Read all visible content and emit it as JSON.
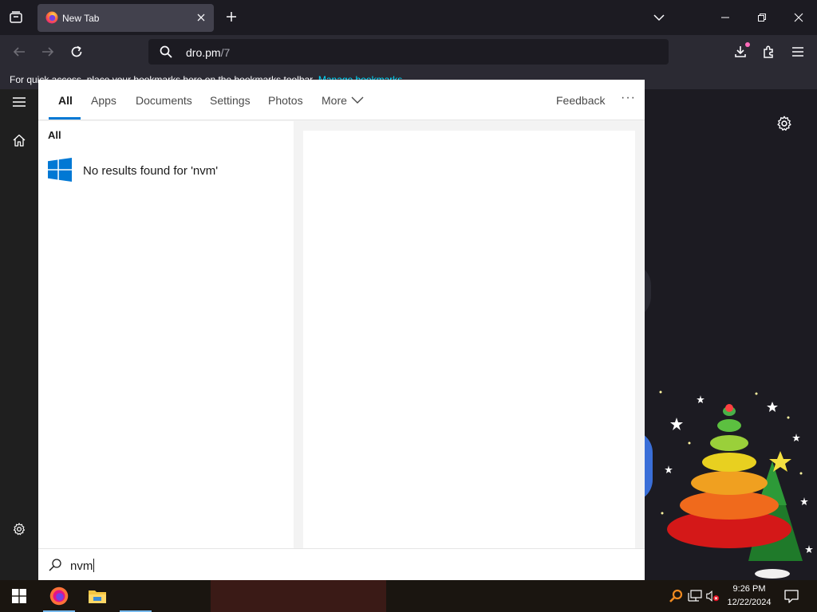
{
  "browser": {
    "tab": {
      "title": "New Tab"
    },
    "url": {
      "host": "dro.pm",
      "path": "/7"
    },
    "bookmarks_bar": {
      "message": "For quick access, place your bookmarks here on the bookmarks toolbar.",
      "link": "Manage bookmarks"
    }
  },
  "search_panel": {
    "tabs": [
      {
        "label": "All",
        "active": true
      },
      {
        "label": "Apps"
      },
      {
        "label": "Documents"
      },
      {
        "label": "Settings"
      },
      {
        "label": "Photos"
      },
      {
        "label": "More"
      }
    ],
    "feedback_label": "Feedback",
    "more_options": "···",
    "section_title": "All",
    "result_text": "No results found for 'nvm'",
    "query": "nvm"
  },
  "taskbar": {
    "time": "9:26 PM",
    "date": "12/22/2024"
  },
  "colors": {
    "accent": "#0078d4",
    "browser_bg": "#1c1b22",
    "toolbar_bg": "#2b2a33",
    "link": "#00ddff"
  }
}
